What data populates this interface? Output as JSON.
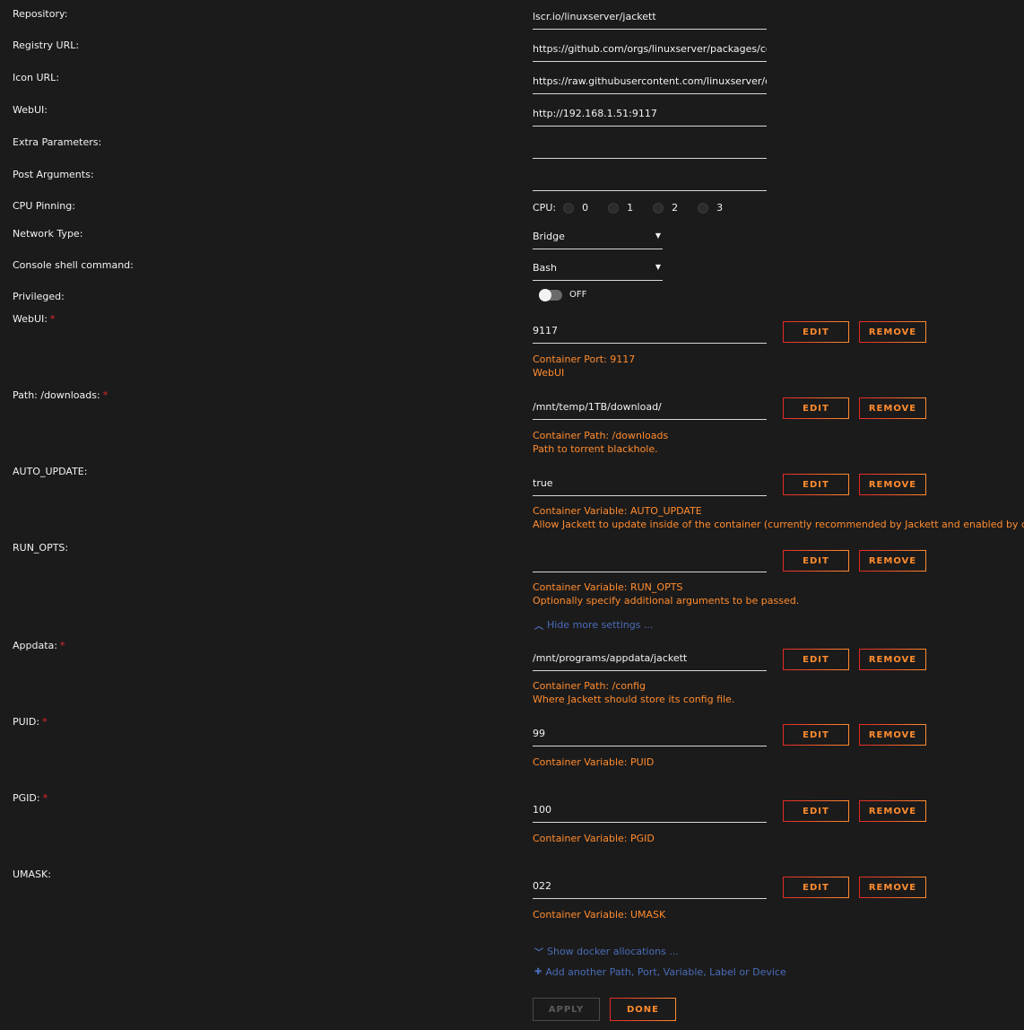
{
  "basic": [
    {
      "label": "Repository:",
      "value": "lscr.io/linuxserver/jackett"
    },
    {
      "label": "Registry URL:",
      "value": "https://github.com/orgs/linuxserver/packages/container/package/jackett"
    },
    {
      "label": "Icon URL:",
      "value": "https://raw.githubusercontent.com/linuxserver/docker-templates/master/linuxserver.io/img/jackett-icon.png"
    },
    {
      "label": "WebUI:",
      "value": "http://192.168.1.51:9117"
    },
    {
      "label": "Extra Parameters:",
      "value": ""
    },
    {
      "label": "Post Arguments:",
      "value": ""
    }
  ],
  "cpu_pinning": {
    "label": "CPU Pinning:",
    "prefix": "CPU:",
    "cores": [
      "0",
      "1",
      "2",
      "3"
    ]
  },
  "network_type": {
    "label": "Network Type:",
    "value": "Bridge"
  },
  "console": {
    "label": "Console shell command:",
    "value": "Bash"
  },
  "privileged": {
    "label": "Privileged:",
    "state": "OFF"
  },
  "buttons": {
    "edit": "EDIT",
    "remove": "REMOVE",
    "apply": "APPLY",
    "done": "DONE"
  },
  "configs": [
    {
      "label": "WebUI:",
      "required": true,
      "value": "9117",
      "desc1": "Container Port: 9117",
      "desc2": "WebUI"
    },
    {
      "label": "Path: /downloads:",
      "required": true,
      "value": "/mnt/temp/1TB/download/",
      "desc1": "Container Path: /downloads",
      "desc2": "Path to torrent blackhole."
    },
    {
      "label": "AUTO_UPDATE:",
      "required": false,
      "value": "true",
      "desc1": "Container Variable: AUTO_UPDATE",
      "desc2": "Allow Jackett to update inside of the container (currently recommended by Jackett and enabled by default)"
    },
    {
      "label": "RUN_OPTS:",
      "required": false,
      "value": "",
      "desc1": "Container Variable: RUN_OPTS",
      "desc2": "Optionally specify additional arguments to be passed."
    },
    {
      "label": "Appdata:",
      "required": true,
      "value": "/mnt/programs/appdata/jackett",
      "desc1": "Container Path: /config",
      "desc2": "Where Jackett should store its config file."
    },
    {
      "label": "PUID:",
      "required": true,
      "value": "99",
      "desc1": "Container Variable: PUID",
      "desc2": ""
    },
    {
      "label": "PGID:",
      "required": true,
      "value": "100",
      "desc1": "Container Variable: PGID",
      "desc2": ""
    },
    {
      "label": "UMASK:",
      "required": false,
      "value": "022",
      "desc1": "Container Variable: UMASK",
      "desc2": ""
    }
  ],
  "links": {
    "hide_more": "Hide more settings ...",
    "show_alloc": "Show docker allocations ...",
    "add_another": "Add another Path, Port, Variable, Label or Device"
  },
  "required_mark": "*",
  "colors": {
    "background": "#1c1b1b",
    "accent": "#ff8c2f",
    "accent2": "#e22828",
    "link": "#486dba"
  }
}
